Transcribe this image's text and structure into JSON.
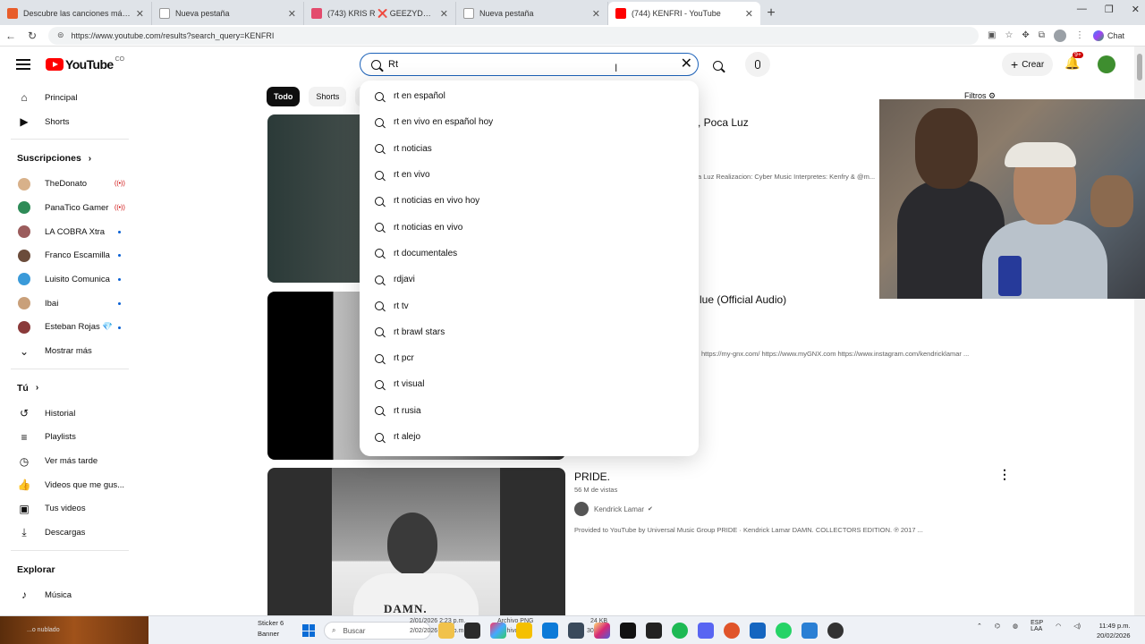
{
  "browser": {
    "tabs": [
      {
        "title": "Descubre las canciones más escuch...",
        "color": "#e85d2a",
        "active": false
      },
      {
        "title": "Nueva pestaña",
        "color": "#ffffff",
        "active": false
      },
      {
        "title": "(743) KRIS R ❌ GEEZYDEE - BOBA...",
        "color": "#e34b6d",
        "active": false
      },
      {
        "title": "Nueva pestaña",
        "color": "#ffffff",
        "active": false
      },
      {
        "title": "(744) KENFRI - YouTube",
        "color": "#ff0000",
        "active": true
      }
    ],
    "new_tab": "+",
    "window_controls": [
      "—",
      "❐",
      "✕"
    ],
    "url": "https://www.youtube.com/results?search_query=KENFRI",
    "chat_label": "Chat"
  },
  "youtube": {
    "logo_text": "YouTube",
    "country_code": "CO",
    "search_value": "Rt",
    "search_placeholder": "Buscar",
    "create_label": "Crear",
    "notifications_badge": "9+",
    "filters_label": "Filtros"
  },
  "suggestions": [
    "rt en español",
    "rt en vivo en español hoy",
    "rt noticias",
    "rt en vivo",
    "rt noticias en vivo hoy",
    "rt noticias en vivo",
    "rt documentales",
    "rdjavi",
    "rt tv",
    "rt brawl stars",
    "rt pcr",
    "rt visual",
    "rt rusia",
    "rt alejo"
  ],
  "sidebar": {
    "main": [
      {
        "label": "Principal",
        "icon": "home-icon"
      },
      {
        "label": "Shorts",
        "icon": "shorts-icon"
      }
    ],
    "subs_heading": "Suscripciones",
    "subscriptions": [
      {
        "label": "TheDonato",
        "color": "#d8b18a",
        "status": "live"
      },
      {
        "label": "PanaTico Gamer",
        "color": "#2e8b57",
        "status": "live"
      },
      {
        "label": "LA COBRA Xtra",
        "color": "#9b5c5c",
        "status": "dot"
      },
      {
        "label": "Franco Escamilla",
        "color": "#6b4c3b",
        "status": "dot"
      },
      {
        "label": "Luisito Comunica",
        "color": "#3a9ad9",
        "status": "dot"
      },
      {
        "label": "Ibai",
        "color": "#c9a07a",
        "status": "dot"
      },
      {
        "label": "Esteban Rojas 💎",
        "color": "#8a3a3a",
        "status": "dot"
      }
    ],
    "show_more": "Mostrar más",
    "you_heading": "Tú",
    "you_items": [
      {
        "label": "Historial",
        "icon": "history-icon"
      },
      {
        "label": "Playlists",
        "icon": "playlists-icon"
      },
      {
        "label": "Ver más tarde",
        "icon": "watch-later-icon"
      },
      {
        "label": "Videos que me gus...",
        "icon": "like-icon"
      },
      {
        "label": "Tus videos",
        "icon": "your-videos-icon"
      },
      {
        "label": "Descargas",
        "icon": "downloads-icon"
      }
    ],
    "explore_heading": "Explorar",
    "explore_items": [
      {
        "label": "Música",
        "icon": "music-icon"
      }
    ]
  },
  "chips": [
    "Todo",
    "Shorts",
    "V"
  ],
  "results": [
    {
      "title_fragment": ", Poca Luz",
      "desc_fragment": "a Luz Realizacion: Cyber Music Interpretes: Kenfry & @m..."
    },
    {
      "title_fragment": "lue (Official Audio)",
      "desc_fragment": "https://my-gnx.com/ https://www.myGNX.com https://www.instagram.com/kendricklamar ..."
    },
    {
      "title": "PRIDE.",
      "views": "56 M de vistas",
      "channel": "Kendrick Lamar",
      "desc": "Provided to YouTube by Universal Music Group PRIDE · Kendrick Lamar DAMN. COLLECTORS EDITION. ℗ 2017 ...",
      "thumb_text": "DAMN."
    }
  ],
  "taskbar": {
    "left_text": "...o nublado",
    "sticker": "Sticker 6",
    "banner": "Banner",
    "search": "Buscar",
    "ghost_1": "2/01/2026 2:23 p.m.",
    "ghost_2": "Archivo PNG",
    "ghost_3": "2/02/2026 2:22 p.m.",
    "ghost_4": "Archivo JPG",
    "ghost_5": "24 KB",
    "ghost_6": "307 KB",
    "lang_1": "ESP",
    "lang_2": "LAA",
    "time": "11:49 p.m.",
    "date": "20/02/2026"
  }
}
